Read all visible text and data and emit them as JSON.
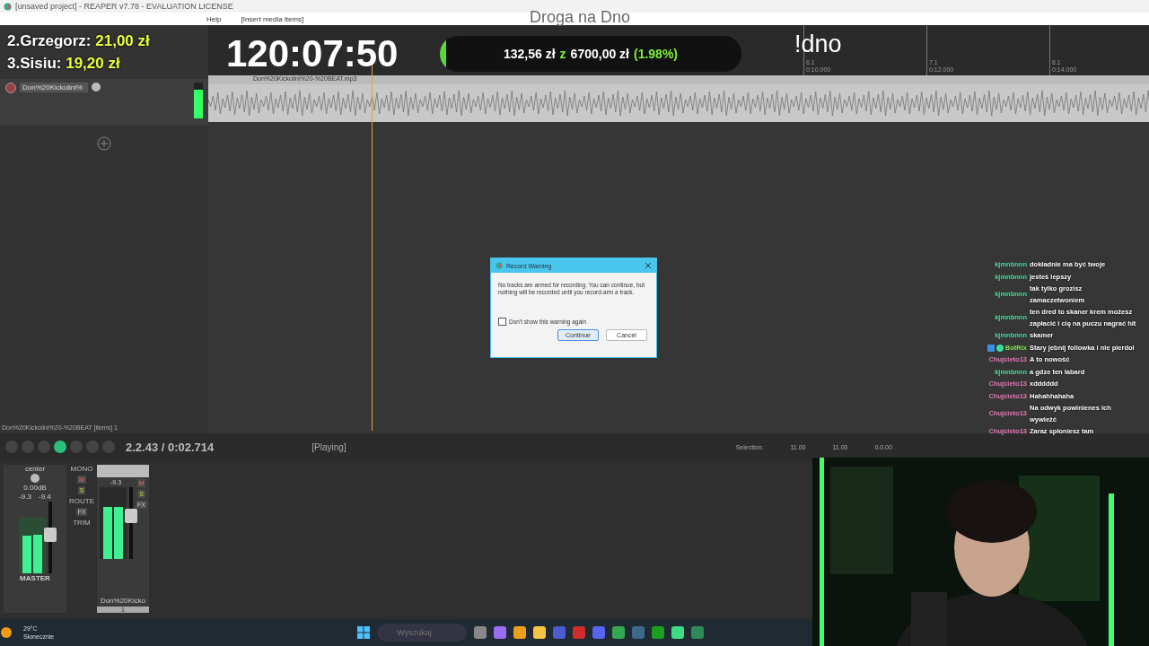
{
  "window": {
    "title": "[unsaved project] - REAPER v7.78 - EVALUATION LICENSE"
  },
  "menu": [
    "Help",
    "[Insert media items]"
  ],
  "overlay": {
    "leaders": [
      {
        "name": "2.Grzegorz:",
        "amount": "21,00 zł"
      },
      {
        "name": "3.Sisiu:",
        "amount": "19,20 zł"
      }
    ],
    "timer": "120:07:50",
    "goal": {
      "raised": "132,56 zł",
      "sep": "z",
      "target": "6700,00 zł",
      "percent": "(1.98%)",
      "level": 0.0198
    },
    "title": "Droga na Dno",
    "command": "!dno"
  },
  "ruler": [
    {
      "bar": "6.1",
      "time": "0:10.000"
    },
    {
      "bar": "7.1",
      "time": "0:12.000"
    },
    {
      "bar": "8.1",
      "time": "0:14.000"
    }
  ],
  "track": {
    "name": "Don%20Kickolini%",
    "armed": false,
    "level": 0.8
  },
  "item": {
    "name": "Don%20Kickolini%20-%20BEAT.mp3"
  },
  "status": "Don%20Kickolini%20-%20BEAT [items] 1",
  "transport": {
    "playing": true,
    "position": "2.2.43 / 0:02.714",
    "state": "[Playing]",
    "selection_label": "Selection:",
    "selection": [
      "11.00",
      "11.00",
      "0.0.00"
    ]
  },
  "mixer": {
    "master": {
      "pan": "center",
      "volume": "0.00dB",
      "peaks": [
        "-9.3",
        "-9.4"
      ],
      "levels": [
        {
          "level": 0.68
        },
        {
          "level": 0.7
        }
      ],
      "fader": {
        "level": 0.55
      },
      "name": "MASTER",
      "mono": "MONO",
      "route": "ROUTE",
      "fx": "FX",
      "trim": "TRIM",
      "mute": "M",
      "solo": "S"
    },
    "strip": {
      "peak": "-9.3",
      "levels": [
        {
          "level": 0.72
        },
        {
          "level": 0.72
        }
      ],
      "fader": {
        "level": 0.62
      },
      "mute": "M",
      "solo": "S",
      "fx": "FX",
      "name": "Don%20Kicko",
      "number": "1"
    }
  },
  "dialog": {
    "title": "Record Warning",
    "message": "No tracks are armed for recording. You can continue, but nothing will be recorded until you record-arm a track.",
    "checkbox": {
      "label": "Don't show this warning again",
      "checked": false
    },
    "buttons": [
      {
        "label": "Continue",
        "selected": true
      },
      {
        "label": "Cancel",
        "selected": false
      }
    ]
  },
  "chat": [
    {
      "user": "kjmnbnnn",
      "color": "#3ddc97",
      "text": "dokładnie ma być twoje"
    },
    {
      "user": "kjmnbnnn",
      "color": "#3ddc97",
      "text": "jesteś lepszy"
    },
    {
      "user": "kjmnbnnn",
      "color": "#3ddc97",
      "text": "tak tylko grozisz zamaczetwoniem"
    },
    {
      "user": "kjmnbnnn",
      "color": "#3ddc97",
      "text": "ten dred to skaner krem możesz zapłacić i cię na puczu nagrać hit"
    },
    {
      "user": "kjmnbnnn",
      "color": "#3ddc97",
      "text": "skamer"
    },
    {
      "user": "BotRix",
      "color": "#7ee04a",
      "text": "Stary jebnij followka i nie pierdol",
      "badges": true
    },
    {
      "user": "Chujcieto13",
      "color": "#e07ab5",
      "text": "A to nowość"
    },
    {
      "user": "kjmnbnnn",
      "color": "#3ddc97",
      "text": "a gdze ten labard"
    },
    {
      "user": "Chujcieto13",
      "color": "#e07ab5",
      "text": "xdddddd"
    },
    {
      "user": "Chujcieto13",
      "color": "#e07ab5",
      "text": "Hahahhahaha"
    },
    {
      "user": "Chujcieto13",
      "color": "#e07ab5",
      "text": "Na odwyk powinienes ich wywieźć"
    },
    {
      "user": "Chujcieto13",
      "color": "#e07ab5",
      "text": "Zaraz spłoniesz tam"
    }
  ],
  "webcam": {
    "kind": "picture"
  },
  "taskbar": {
    "temperature": "29°C",
    "weather": "Słonecznie",
    "search": {
      "placeholder": "Wyszukaj"
    }
  }
}
